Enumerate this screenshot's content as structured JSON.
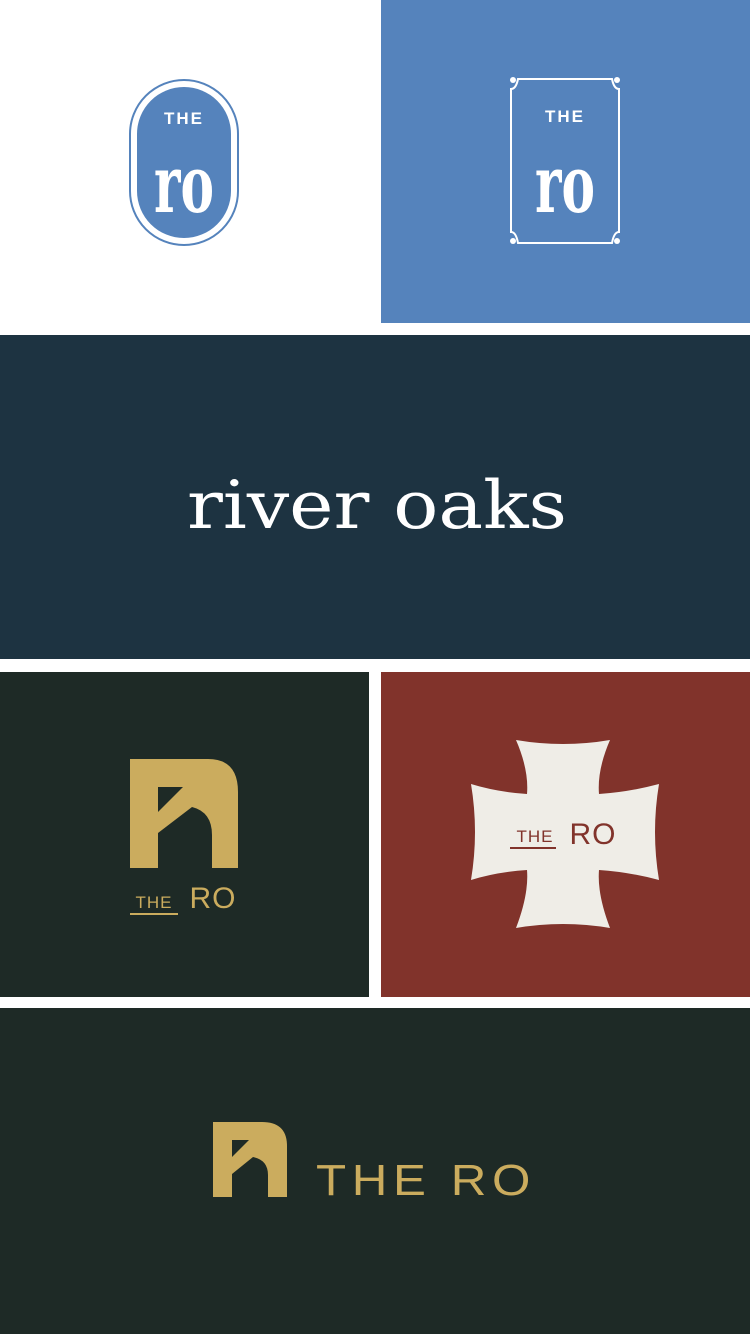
{
  "colors": {
    "white": "#ffffff",
    "blue": "#5583bc",
    "navy": "#1d3341",
    "dark_green": "#1e2a26",
    "red": "#81332b",
    "gold": "#cbac5e",
    "cream": "#efede7"
  },
  "panels": {
    "oval_badge": {
      "the": "THE",
      "mono": "ro"
    },
    "rect_badge": {
      "the": "THE",
      "mono": "ro"
    },
    "wordmark": {
      "text": "river oaks"
    },
    "stacked_logo": {
      "the": "THE",
      "ro": "RO"
    },
    "cross_badge": {
      "the": "THE",
      "ro": "RO"
    },
    "horizontal_logo": {
      "text": "THE RO"
    }
  }
}
